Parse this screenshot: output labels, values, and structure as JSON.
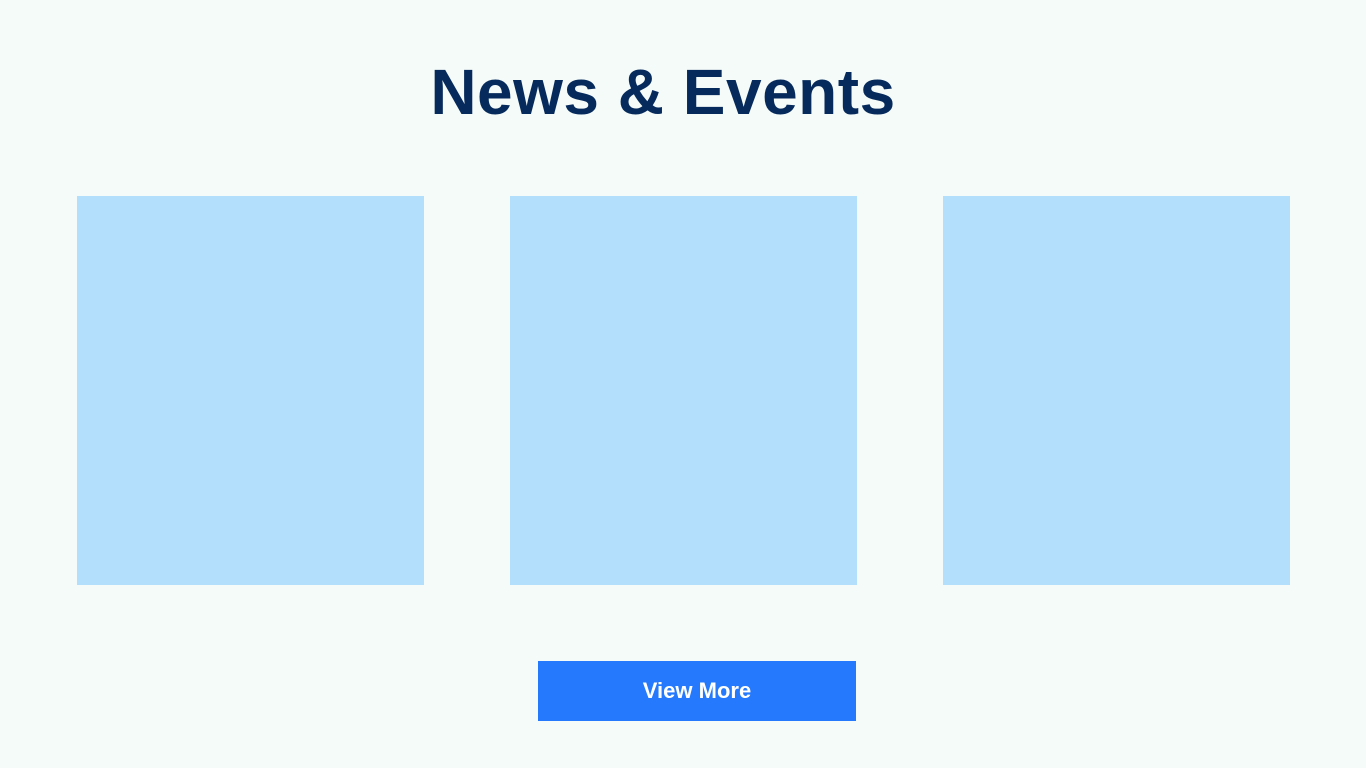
{
  "section": {
    "title": "News & Events",
    "cards": [
      {
        "label": ""
      },
      {
        "label": ""
      },
      {
        "label": ""
      }
    ],
    "view_more_label": "View More"
  },
  "colors": {
    "background": "#f4fbf9",
    "title": "#062a5b",
    "card_placeholder": "#b3dffc",
    "button": "#2479fc",
    "button_text": "#ffffff"
  }
}
